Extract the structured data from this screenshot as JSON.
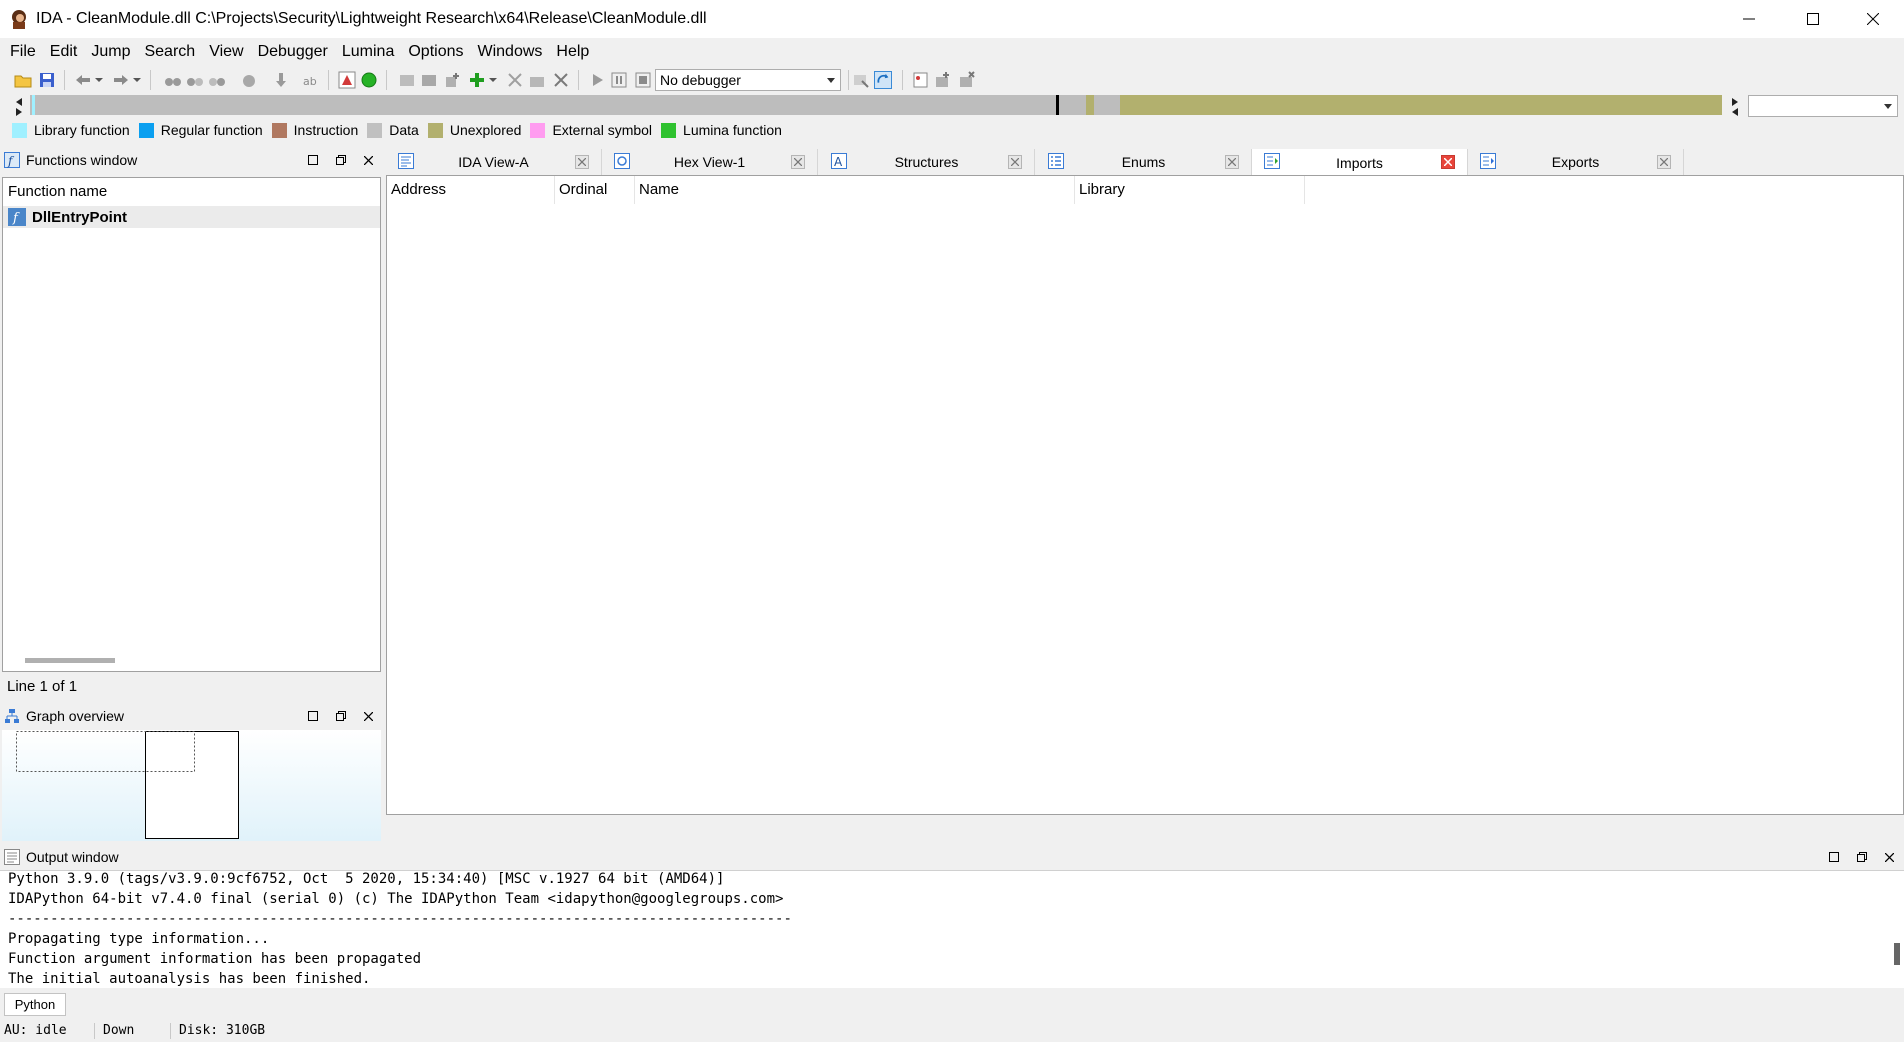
{
  "window": {
    "title": "IDA - CleanModule.dll C:\\Projects\\Security\\Lightweight Research\\x64\\Release\\CleanModule.dll"
  },
  "menu": [
    {
      "label": "File"
    },
    {
      "label": "Edit"
    },
    {
      "label": "Jump"
    },
    {
      "label": "Search"
    },
    {
      "label": "View"
    },
    {
      "label": "Debugger"
    },
    {
      "label": "Lumina"
    },
    {
      "label": "Options"
    },
    {
      "label": "Windows"
    },
    {
      "label": "Help"
    }
  ],
  "toolbar": {
    "debugger_select": "No debugger"
  },
  "legend": [
    {
      "label": "Library function",
      "color": "#a0f0ff"
    },
    {
      "label": "Regular function",
      "color": "#0a9ff0"
    },
    {
      "label": "Instruction",
      "color": "#b07860"
    },
    {
      "label": "Data",
      "color": "#c0c0c0"
    },
    {
      "label": "Unexplored",
      "color": "#b2b06e"
    },
    {
      "label": "External symbol",
      "color": "#ff9cf0"
    },
    {
      "label": "Lumina function",
      "color": "#2fc22f"
    }
  ],
  "functions_window": {
    "title": "Functions window",
    "column": "Function name",
    "items": [
      {
        "name": "DllEntryPoint"
      }
    ],
    "line_info": "Line 1 of 1"
  },
  "graph_overview": {
    "title": "Graph overview"
  },
  "tabs": [
    {
      "label": "IDA View-A"
    },
    {
      "label": "Hex View-1"
    },
    {
      "label": "Structures"
    },
    {
      "label": "Enums"
    },
    {
      "label": "Imports",
      "active": true
    },
    {
      "label": "Exports"
    }
  ],
  "imports_table": {
    "columns": [
      "Address",
      "Ordinal",
      "Name",
      "Library"
    ],
    "rows": []
  },
  "output_window": {
    "title": "Output window",
    "lines": [
      "Python 3.9.0 (tags/v3.9.0:9cf6752, Oct  5 2020, 15:34:40) [MSC v.1927 64 bit (AMD64)]",
      "IDAPython 64-bit v7.4.0 final (serial 0) (c) The IDAPython Team <idapython@googlegroups.com>",
      "---------------------------------------------------------------------------------------------",
      "Propagating type information...",
      "Function argument information has been propagated",
      "The initial autoanalysis has been finished."
    ]
  },
  "python_bar": {
    "button": "Python"
  },
  "statusbar": {
    "au": "AU:  idle",
    "direction": "Down",
    "disk": "Disk: 310GB"
  }
}
